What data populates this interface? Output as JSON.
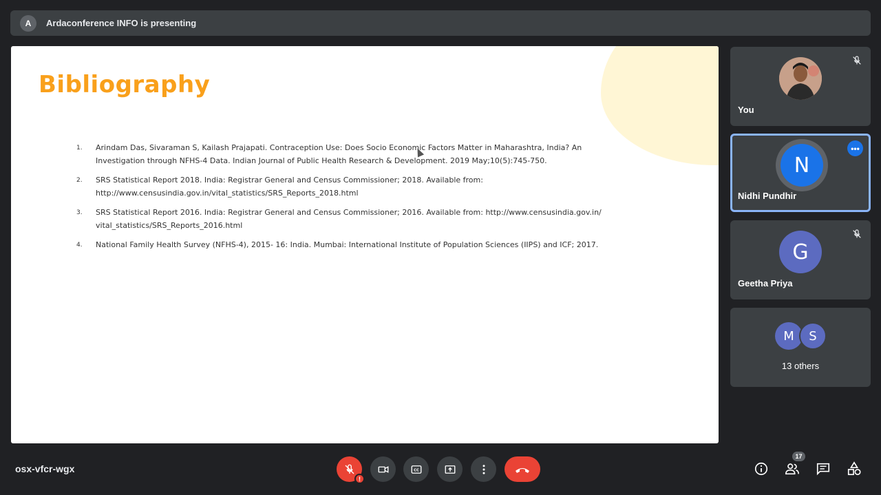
{
  "presenter": {
    "avatar_letter": "A",
    "text": "Ardaconference INFO is presenting"
  },
  "slide": {
    "title": "Bibliography",
    "references": [
      {
        "num": "1.",
        "text": "Arindam Das, Sivaraman S, Kailash Prajapati. Contraception Use: Does Socio Economic Factors Matter in Maharashtra, India? An Investigation through NFHS-4 Data. Indian Journal of Public Health Research & Development. 2019 May;10(5):745-750."
      },
      {
        "num": "2.",
        "text": "SRS Statistical Report 2018. India: Registrar General and Census Commissioner; 2018. Available from: http://www.censusindia.gov.in/vital_statistics/SRS_Reports_2018.html"
      },
      {
        "num": "3.",
        "text": "SRS Statistical Report 2016. India: Registrar General and Census Commissioner; 2016. Available from: http://www.censusindia.gov.in/ vital_statistics/SRS_Reports_2016.html"
      },
      {
        "num": "4.",
        "text": "National Family Health Survey (NFHS-4), 2015- 16: India. Mumbai: International Institute of Population Sciences (IIPS) and ICF;  2017."
      }
    ]
  },
  "participants": {
    "you": {
      "name": "You"
    },
    "nidhi": {
      "name": "Nidhi Pundhir",
      "letter": "N",
      "color": "#1a73e8"
    },
    "geetha": {
      "name": "Geetha Priya",
      "letter": "G",
      "color": "#5c6bc0"
    },
    "others": {
      "letters": [
        "M",
        "S"
      ],
      "label": "13 others",
      "colors": [
        "#5c6bc0",
        "#5c6bc0"
      ]
    }
  },
  "toolbar": {
    "meeting_code": "osx-vfcr-wgx",
    "mic_warning": "!",
    "people_count": "17"
  },
  "colors": {
    "accent": "#f9a01b",
    "danger": "#ea4335",
    "primary": "#1a73e8"
  }
}
